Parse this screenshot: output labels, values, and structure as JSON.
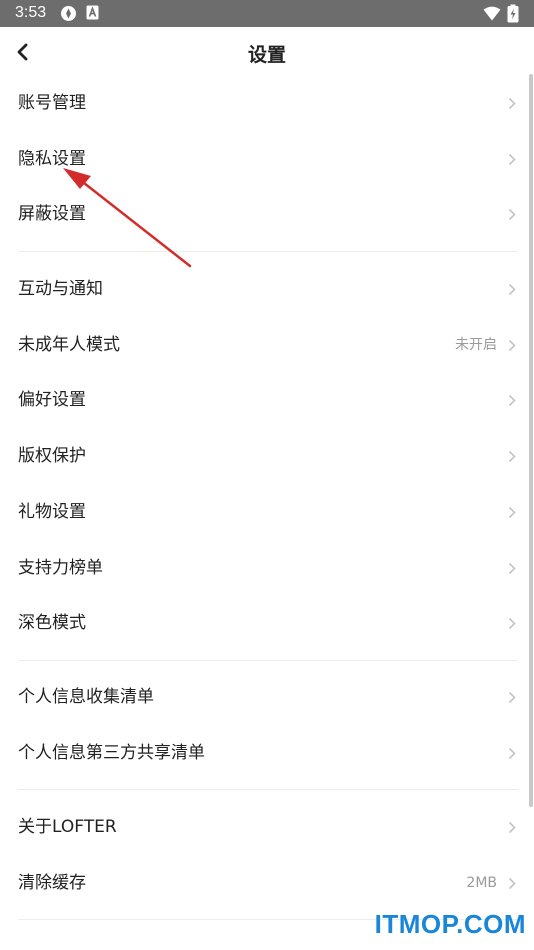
{
  "status_bar": {
    "time": "3:53"
  },
  "header": {
    "title": "设置"
  },
  "sections": [
    {
      "items": [
        {
          "label": "账号管理",
          "value": ""
        },
        {
          "label": "隐私设置",
          "value": ""
        },
        {
          "label": "屏蔽设置",
          "value": ""
        }
      ]
    },
    {
      "items": [
        {
          "label": "互动与通知",
          "value": ""
        },
        {
          "label": "未成年人模式",
          "value": "未开启"
        },
        {
          "label": "偏好设置",
          "value": ""
        },
        {
          "label": "版权保护",
          "value": ""
        },
        {
          "label": "礼物设置",
          "value": ""
        },
        {
          "label": "支持力榜单",
          "value": ""
        },
        {
          "label": "深色模式",
          "value": ""
        }
      ]
    },
    {
      "items": [
        {
          "label": "个人信息收集清单",
          "value": ""
        },
        {
          "label": "个人信息第三方共享清单",
          "value": ""
        }
      ]
    },
    {
      "items": [
        {
          "label": "关于LOFTER",
          "value": ""
        },
        {
          "label": "清除缓存",
          "value": "2MB"
        }
      ]
    }
  ],
  "annotation": {
    "arrow_color": "#d42b2b"
  },
  "watermark": {
    "text": "ITMOP.COM",
    "color": "#1a86d8"
  }
}
